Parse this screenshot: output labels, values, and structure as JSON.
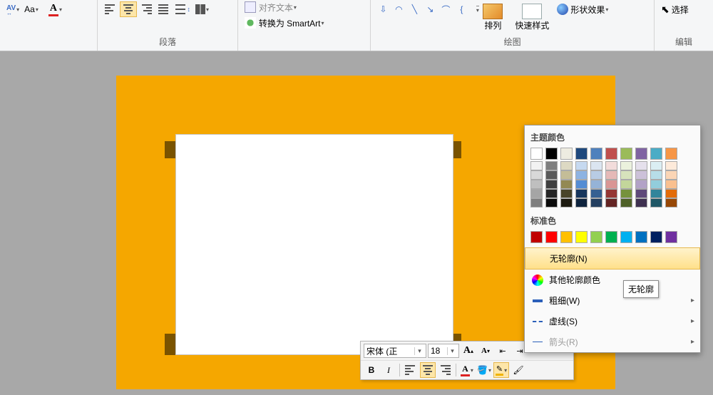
{
  "ribbon": {
    "font_group": {
      "char_spacing_label": "AV",
      "change_case_label": "Aa",
      "font_color_letter": "A"
    },
    "paragraph_group": {
      "label": "段落"
    },
    "smartart": {
      "align_text_label": "对齐文本",
      "convert_label": "转换为 SmartArt"
    },
    "drawing_group": {
      "label": "绘图",
      "arrange_label": "排列",
      "quick_styles_label": "快速样式",
      "shape_effects_label": "形状效果"
    },
    "edit_group": {
      "label": "编辑",
      "select_label": "选择"
    }
  },
  "minibar": {
    "font_name": "宋体 (正",
    "font_size": "18",
    "grow_font": "A",
    "shrink_font": "A",
    "bold": "B",
    "italic": "I",
    "font_color_letter": "A"
  },
  "picker": {
    "theme_title": "主题颜色",
    "standard_title": "标准色",
    "theme_colors": [
      "#ffffff",
      "#000000",
      "#eeece1",
      "#1f497d",
      "#4f81bd",
      "#c0504d",
      "#9bbb59",
      "#8064a2",
      "#4bacc6",
      "#f79646"
    ],
    "theme_shades": [
      [
        "#f2f2f2",
        "#d8d8d8",
        "#bfbfbf",
        "#a5a5a5",
        "#7f7f7f"
      ],
      [
        "#7f7f7f",
        "#595959",
        "#3f3f3f",
        "#262626",
        "#0c0c0c"
      ],
      [
        "#ddd9c3",
        "#c4bd97",
        "#938953",
        "#494429",
        "#1d1b10"
      ],
      [
        "#c6d9f0",
        "#8db3e2",
        "#548dd4",
        "#17365d",
        "#0f243e"
      ],
      [
        "#dbe5f1",
        "#b8cce4",
        "#95b3d7",
        "#366092",
        "#244061"
      ],
      [
        "#f2dcdb",
        "#e5b9b7",
        "#d99694",
        "#953734",
        "#632423"
      ],
      [
        "#ebf1dd",
        "#d7e3bc",
        "#c3d69b",
        "#76923c",
        "#4f6128"
      ],
      [
        "#e5e0ec",
        "#ccc1d9",
        "#b2a2c7",
        "#5f497a",
        "#3f3151"
      ],
      [
        "#dbeef3",
        "#b7dde8",
        "#92cddc",
        "#31859b",
        "#205867"
      ],
      [
        "#fdeada",
        "#fbd5b5",
        "#fac08f",
        "#e36c09",
        "#974806"
      ]
    ],
    "standard_colors": [
      "#c00000",
      "#ff0000",
      "#ffc000",
      "#ffff00",
      "#92d050",
      "#00b050",
      "#00b0f0",
      "#0070c0",
      "#002060",
      "#7030a0"
    ],
    "no_outline_label": "无轮廓(N)",
    "more_colors_label": "其他轮廓颜色",
    "weight_label": "粗细(W)",
    "dashes_label": "虚线(S)",
    "arrows_label": "箭头(R)"
  },
  "tooltip": "无轮廓"
}
